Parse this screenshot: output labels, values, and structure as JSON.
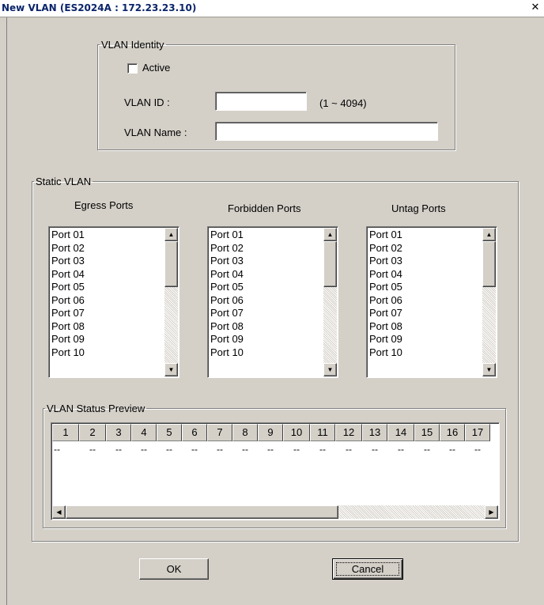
{
  "window": {
    "title": "New VLAN (ES2024A : 172.23.23.10)",
    "close_glyph": "✕"
  },
  "vlan_identity": {
    "legend": "VLAN Identity",
    "active_label": "Active",
    "active_checked": false,
    "vlan_id_label": "VLAN ID :",
    "vlan_id_value": "",
    "vlan_id_range": "(1 ~ 4094)",
    "vlan_name_label": "VLAN Name :",
    "vlan_name_value": ""
  },
  "static_vlan": {
    "legend": "Static VLAN",
    "egress": {
      "title": "Egress Ports",
      "items": [
        "Port 01",
        "Port 02",
        "Port 03",
        "Port 04",
        "Port 05",
        "Port 06",
        "Port 07",
        "Port 08",
        "Port 09",
        "Port 10"
      ]
    },
    "forbidden": {
      "title": "Forbidden Ports",
      "items": [
        "Port 01",
        "Port 02",
        "Port 03",
        "Port 04",
        "Port 05",
        "Port 06",
        "Port 07",
        "Port 08",
        "Port 09",
        "Port 10"
      ]
    },
    "untag": {
      "title": "Untag Ports",
      "items": [
        "Port 01",
        "Port 02",
        "Port 03",
        "Port 04",
        "Port 05",
        "Port 06",
        "Port 07",
        "Port 08",
        "Port 09",
        "Port 10"
      ]
    }
  },
  "status_preview": {
    "legend": "VLAN Status Preview",
    "columns": [
      "1",
      "2",
      "3",
      "4",
      "5",
      "6",
      "7",
      "8",
      "9",
      "10",
      "11",
      "12",
      "13",
      "14",
      "15",
      "16",
      "17"
    ],
    "values": [
      "--",
      "--",
      "--",
      "--",
      "--",
      "--",
      "--",
      "--",
      "--",
      "--",
      "--",
      "--",
      "--",
      "--",
      "--",
      "--",
      "--"
    ]
  },
  "icons": {
    "scroll_up": "up-arrow-icon",
    "scroll_down": "down-arrow-icon",
    "scroll_left": "left-arrow-icon",
    "scroll_right": "right-arrow-icon"
  },
  "buttons": {
    "ok": "OK",
    "cancel": "Cancel"
  }
}
